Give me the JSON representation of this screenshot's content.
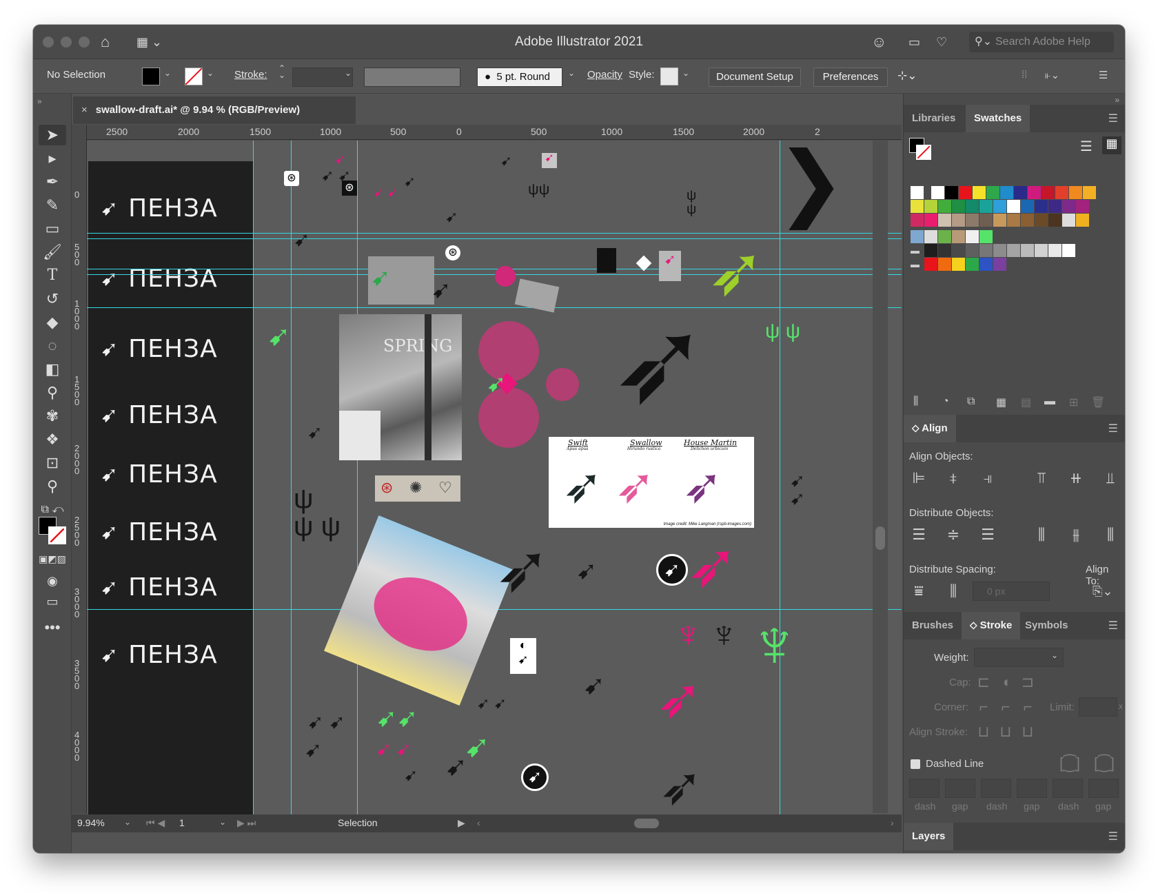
{
  "app": {
    "title": "Adobe Illustrator 2021",
    "help_placeholder": "Search Adobe Help"
  },
  "control_bar": {
    "selection": "No Selection",
    "stroke_label": "Stroke:",
    "brush": "5 pt. Round",
    "opacity_label": "Opacity",
    "style_label": "Style:",
    "doc_setup": "Document Setup",
    "preferences": "Preferences"
  },
  "document": {
    "tab_title": "swallow-draft.ai* @ 9.94 % (RGB/Preview)",
    "close": "×"
  },
  "hruler_labels": [
    "2500",
    "2000",
    "1500",
    "1000",
    "500",
    "0",
    "500",
    "1000",
    "1500",
    "2000",
    "2"
  ],
  "vruler_labels": [
    "0",
    "500",
    "1000",
    "1500",
    "2000",
    "2500",
    "3000",
    "3500",
    "4000"
  ],
  "artboard_text": [
    "ПЕНЗА",
    "ПЕНЗА",
    "ПЕНЗА",
    "ПЕНЗА",
    "ПЕНЗА",
    "ПЕНЗА",
    "ПЕНЗА",
    "ПЕНЗА"
  ],
  "reference_card": {
    "cols": [
      {
        "name": "Swift",
        "latin": "Apus apus"
      },
      {
        "name": "Swallow",
        "latin": "Hirundo rustica"
      },
      {
        "name": "House Martin",
        "latin": "Delichon urbicum"
      }
    ],
    "credit": "Image credit: Mike Langman (rspb-images.com)"
  },
  "photo_text": "SPRING",
  "status": {
    "zoom": "9.94%",
    "artboard": "1",
    "tool": "Selection"
  },
  "panels": {
    "top_tabs": [
      "Libraries",
      "Swatches"
    ],
    "align": {
      "title": "Align",
      "align_objects": "Align Objects:",
      "distribute_objects": "Distribute Objects:",
      "distribute_spacing": "Distribute Spacing:",
      "align_to": "Align To:",
      "spacing_value": "0 px"
    },
    "mid_tabs": [
      "Brushes",
      "Stroke",
      "Symbols"
    ],
    "stroke": {
      "weight": "Weight:",
      "cap": "Cap:",
      "corner": "Corner:",
      "limit": "Limit:",
      "limit_x": "x",
      "align_stroke": "Align Stroke:",
      "dashed": "Dashed Line",
      "dash_labels": [
        "dash",
        "gap",
        "dash",
        "gap",
        "dash",
        "gap"
      ]
    },
    "layers": "Layers"
  },
  "colors": {
    "accent_guide": "#38d9e4",
    "pink": "#e8157a",
    "green": "#55e36a",
    "lime": "#9ed02a",
    "swatch_row1": [
      "#ffffff",
      "#000000",
      "#e8141c",
      "#f5e12a",
      "#2ea84a",
      "#1f8ccc",
      "#2a2a8a",
      "#d11a7d",
      "#c6162a",
      "#e2402a",
      "#f08a1e",
      "#f4b025"
    ],
    "swatch_row2": [
      "#e9e23a",
      "#b4d23a",
      "#42ad3d",
      "#1f8f44",
      "#138a6a",
      "#1aa39a",
      "#2f9fda",
      "#ffffff",
      "#1c67b1",
      "#2b2f8c",
      "#3e2a86",
      "#7f2a8a",
      "#a3227e"
    ],
    "swatch_row3": [
      "#d02a63",
      "#ea1e6f",
      "#cfc1b0",
      "#b39b86",
      "#8d7a6a",
      "#6f5f52",
      "#c79a5c",
      "#a97a45",
      "#8a5f32",
      "#6b4a28",
      "#4b3420",
      "#dddddd",
      "#f0b020"
    ],
    "swatch_gray": [
      "#1e1e1e",
      "#333333",
      "#4a4a4a",
      "#5f5f5f",
      "#777777",
      "#8c8c8c",
      "#a4a4a4",
      "#bbbbbb",
      "#d2d2d2",
      "#e8e8e8",
      "#ffffff"
    ],
    "swatch_bright": [
      "#e8141c",
      "#f06a10",
      "#f5d21e",
      "#2aa84a",
      "#2d53c4",
      "#7b3fa0"
    ]
  },
  "icons": [
    "home-icon",
    "workspace-icon",
    "share-icon",
    "lightbulb-icon",
    "selection-tool-icon",
    "direct-selection-icon",
    "pen-tool-icon",
    "type-tool-icon",
    "zoom-tool-icon",
    "swallow-icon"
  ]
}
